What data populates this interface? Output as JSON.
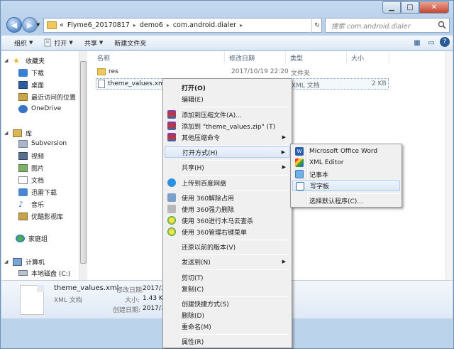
{
  "address": {
    "chevrons": "«",
    "crumbs": [
      "Flyme6_20170817",
      "demo6",
      "com.android.dialer"
    ],
    "arrow": "▸"
  },
  "search": {
    "placeholder": "搜索 com.android.dialer"
  },
  "toolbar": {
    "organize": "组织",
    "open": "打开",
    "share": "共享",
    "new_folder": "新建文件夹"
  },
  "sidebar": {
    "favorites": "收藏夹",
    "downloads": "下载",
    "desktop": "桌面",
    "recent": "最近访问的位置",
    "onedrive": "OneDrive",
    "library": "库",
    "subversion": "Subversion",
    "videos": "视频",
    "pictures": "图片",
    "documents": "文档",
    "xunlei": "迅雷下载",
    "music": "音乐",
    "youku": "优酷影视库",
    "homegroup": "家庭组",
    "computer": "计算机",
    "local_disk": "本地磁盘 (C:)"
  },
  "columns": {
    "name": "名称",
    "date": "修改日期",
    "type": "类型",
    "size": "大小"
  },
  "files": [
    {
      "name": "res",
      "date": "2017/10/19 22:20",
      "type": "文件夹",
      "size": ""
    },
    {
      "name": "theme_values.xml",
      "date": "",
      "type": "XML 文档",
      "size": "2 KB"
    }
  ],
  "details": {
    "filename": "theme_values.xml",
    "filetype": "XML 文档",
    "modified_label": "修改日期:",
    "modified_value": "2017/3/",
    "size_label": "大小:",
    "size_value": "1.43 KB",
    "created_label": "创建日期:",
    "created_value": "2017/10/"
  },
  "context_menu": {
    "open": "打开(O)",
    "edit": "编辑(E)",
    "add_archive": "添加到压缩文件(A)...",
    "add_zip": "添加到 \"theme_values.zip\" (T)",
    "other_compress": "其他压缩命令",
    "open_with": "打开方式(H)",
    "share": "共享(H)",
    "baidu": "上传到百度网盘",
    "unlock360": "使用 360解除占用",
    "delete360": "使用 360强力删除",
    "scan360": "使用 360进行木马云查杀",
    "menu360": "使用 360管理右键菜单",
    "restore": "还原以前的版本(V)",
    "send_to": "发送到(N)",
    "cut": "剪切(T)",
    "copy": "复制(C)",
    "shortcut": "创建快捷方式(S)",
    "delete": "删除(D)",
    "rename": "重命名(M)",
    "properties": "属性(R)"
  },
  "submenu": {
    "word": "Microsoft Office Word",
    "xml_editor": "XML Editor",
    "notepad": "记事本",
    "wordpad": "写字板",
    "choose": "选择默认程序(C)..."
  },
  "colors": {
    "highlight": "#dce9f8",
    "folder": "#f0c860",
    "title_bg": "#c5daf0"
  }
}
